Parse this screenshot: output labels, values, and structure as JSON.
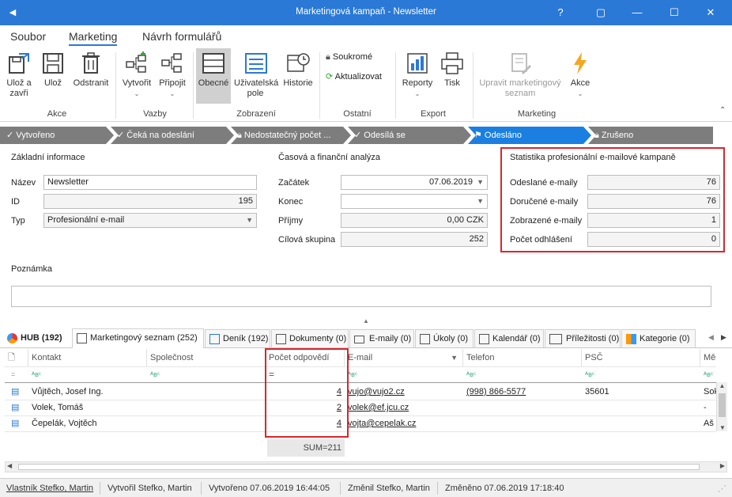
{
  "window": {
    "title": "Marketingová kampaň - Newsletter",
    "help": "?",
    "restore": "▢",
    "minimize": "—",
    "maximize": "☐",
    "close": "✕"
  },
  "menu": {
    "items": [
      "Soubor",
      "Marketing",
      "Návrh formulářů"
    ],
    "active": "Marketing"
  },
  "ribbon": {
    "akce": {
      "label": "Akce",
      "buttons": [
        "Ulož a zavři",
        "Ulož",
        "Odstranit"
      ]
    },
    "vazby": {
      "label": "Vazby",
      "buttons": [
        "Vytvořit",
        "Připojit"
      ]
    },
    "zobrazeni": {
      "label": "Zobrazení",
      "buttons": [
        "Obecné",
        "Uživatelská pole",
        "Historie"
      ]
    },
    "ostatni": {
      "label": "Ostatní",
      "buttons": [
        "Soukromé",
        "Aktualizovat"
      ]
    },
    "export": {
      "label": "Export",
      "buttons": [
        "Reporty",
        "Tisk"
      ]
    },
    "marketing": {
      "label": "Marketing",
      "buttons": [
        "Upravit marketingový seznam",
        "Akce"
      ]
    }
  },
  "workflow": [
    "Vytvořeno",
    "Čeká na odeslání",
    "Nedostatečný počet ...",
    "Odesílá se",
    "Odesláno",
    "Zrušeno"
  ],
  "basic": {
    "title": "Základní informace",
    "name_label": "Název",
    "name": "Newsletter",
    "id_label": "ID",
    "id": "195",
    "type_label": "Typ",
    "type": "Profesionální e-mail"
  },
  "time": {
    "title": "Časová a finanční analýza",
    "start_label": "Začátek",
    "start": "07.06.2019",
    "end_label": "Konec",
    "end": "",
    "income_label": "Příjmy",
    "income": "0,00 CZK",
    "target_label": "Cílová skupina",
    "target": "252"
  },
  "stats": {
    "title": "Statistika profesionální e-mailové kampaně",
    "sent_label": "Odeslané e-maily",
    "sent": "76",
    "delivered_label": "Doručené e-maily",
    "delivered": "76",
    "shown_label": "Zobrazené e-maily",
    "shown": "1",
    "unsub_label": "Počet odhlášení",
    "unsub": "0"
  },
  "note": {
    "label": "Poznámka",
    "value": ""
  },
  "tabs": [
    "HUB (192)",
    "Marketingový seznam (252)",
    "Deník (192)",
    "Dokumenty (0)",
    "E-maily (0)",
    "Úkoly (0)",
    "Kalendář (0)",
    "Příležitosti (0)",
    "Kategorie (0)"
  ],
  "grid": {
    "headers": [
      "Kontakt",
      "Společnost",
      "Počet odpovědí",
      "E-mail",
      "Telefon",
      "PSČ",
      "Město"
    ],
    "filter_glyph": "ᴬʙᶜ",
    "filter_eq": "=",
    "rows": [
      {
        "contact": "Vůjtěch, Josef Ing.",
        "company": "",
        "replies": "4",
        "email": "vujo@vujo2.cz",
        "phone": "(998) 866-5577",
        "zip": "35601",
        "city": "Sok"
      },
      {
        "contact": "Volek, Tomáš",
        "company": "",
        "replies": "2",
        "email": "volek@ef.jcu.cz",
        "phone": "",
        "zip": "",
        "city": "-"
      },
      {
        "contact": "Čepelák, Vojtěch",
        "company": "",
        "replies": "4",
        "email": "vojta@cepelak.cz",
        "phone": "",
        "zip": "",
        "city": "Aš"
      }
    ],
    "sum": "SUM=211"
  },
  "status": {
    "owner": "Vlastník Stefko, Martin",
    "created_by": "Vytvořil Stefko, Martin",
    "created": "Vytvořeno 07.06.2019 16:44:05",
    "changed_by": "Změnil Stefko, Martin",
    "changed": "Změněno 07.06.2019 17:18:40"
  },
  "colors": {
    "titlebar": "#2b79d6",
    "workflow_active": "#1a7fe0",
    "workflow": "#7d7d7d",
    "highlight": "#d9262e"
  }
}
